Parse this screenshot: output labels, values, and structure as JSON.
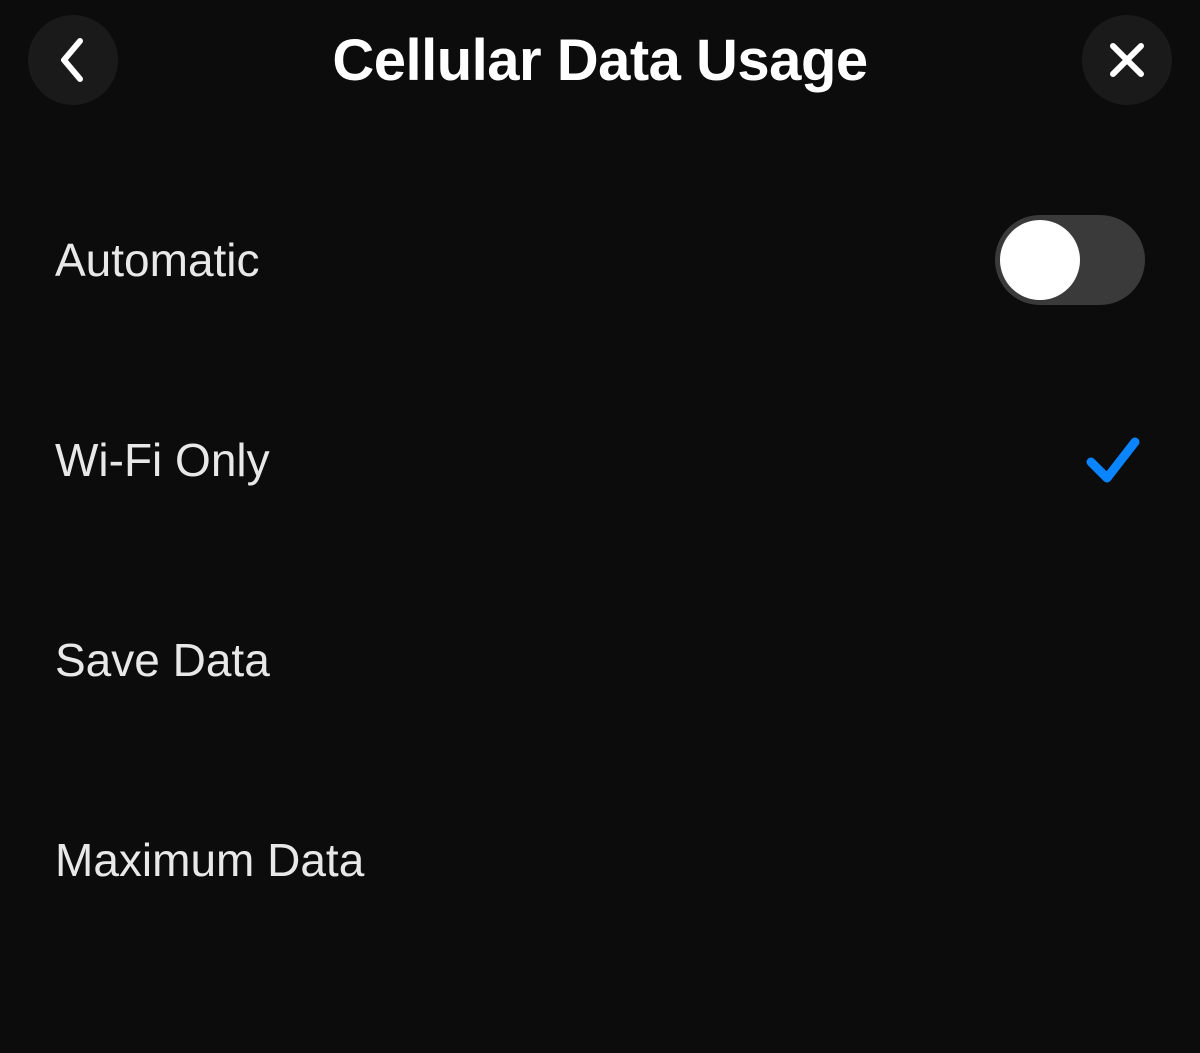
{
  "header": {
    "title": "Cellular Data Usage"
  },
  "rows": {
    "automatic": {
      "label": "Automatic",
      "toggle_on": false
    },
    "wifi_only": {
      "label": "Wi-Fi Only",
      "selected": true
    },
    "save_data": {
      "label": "Save Data",
      "selected": false
    },
    "maximum_data": {
      "label": "Maximum Data",
      "selected": false
    }
  },
  "colors": {
    "background": "#0c0c0c",
    "button_bg": "#1a1a1a",
    "toggle_off_bg": "#3a3a3a",
    "checkmark": "#0a84ff",
    "text": "#e8e8e8"
  }
}
